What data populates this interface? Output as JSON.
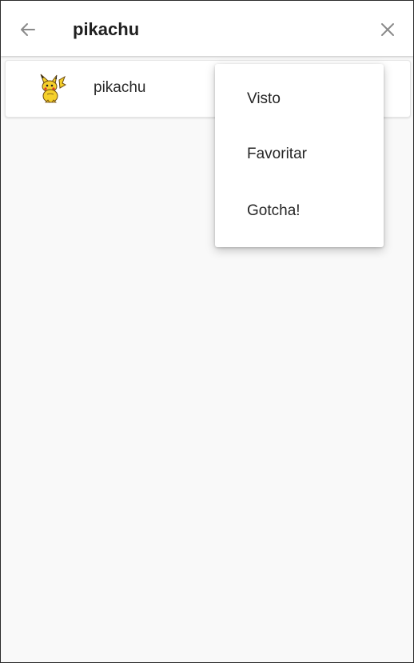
{
  "app_bar": {
    "back_icon": "arrow-left-icon",
    "search_query": "pikachu",
    "clear_icon": "close-icon"
  },
  "results": [
    {
      "name": "pikachu",
      "sprite_icon": "pikachu-sprite"
    }
  ],
  "popup_menu": {
    "items": [
      {
        "label": "Visto"
      },
      {
        "label": "Favoritar"
      },
      {
        "label": "Gotcha!"
      }
    ]
  },
  "colors": {
    "background": "#f9f9f9",
    "surface": "#ffffff",
    "text_primary": "#202020",
    "icon_gray": "#8a8a8a",
    "pikachu_yellow": "#f5d02a"
  }
}
